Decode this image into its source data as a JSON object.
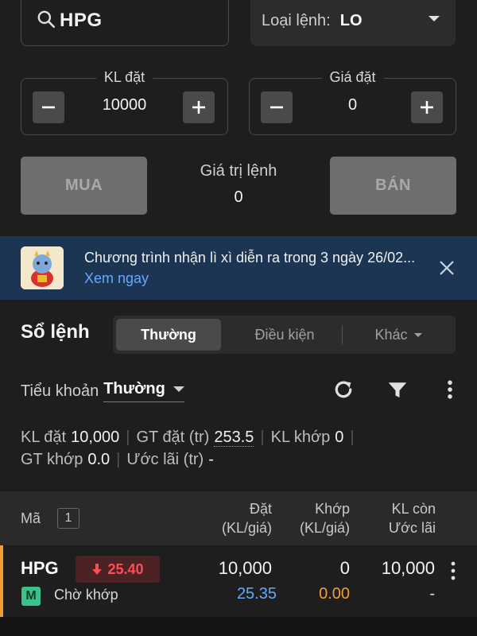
{
  "search": {
    "value": "HPG"
  },
  "order_type": {
    "label": "Loại lệnh:",
    "value": "LO"
  },
  "quantity": {
    "label": "KL đặt",
    "value": "10000"
  },
  "price": {
    "label": "Giá đặt",
    "value": "0"
  },
  "buy": {
    "label": "MUA"
  },
  "sell": {
    "label": "BÁN"
  },
  "order_value": {
    "label": "Giá trị lệnh",
    "value": "0"
  },
  "banner": {
    "text": "Chương trình nhận lì xì diễn ra trong 3 ngày 26/02...",
    "link": "Xem ngay"
  },
  "order_book": {
    "title": "Sổ lệnh",
    "tabs": [
      {
        "label": "Thường",
        "active": true
      },
      {
        "label": "Điều kiện",
        "active": false
      },
      {
        "label": "Khác",
        "active": false
      }
    ]
  },
  "sub_account": {
    "label": "Tiểu khoản",
    "value": "Thường"
  },
  "stats": {
    "kl_dat_label": "KL đặt",
    "kl_dat_value": "10,000",
    "gt_dat_label": "GT đặt (tr)",
    "gt_dat_value": "253.5",
    "kl_khop_label": "KL khớp",
    "kl_khop_value": "0",
    "gt_khop_label": "GT khớp",
    "gt_khop_value": "0.0",
    "uoc_lai_label": "Ước lãi (tr)",
    "uoc_lai_value": "-"
  },
  "table": {
    "col_code": "Mã",
    "count": "1",
    "col_dat_1": "Đặt",
    "col_dat_2": "(KL/giá)",
    "col_khop_1": "Khớp",
    "col_khop_2": "(KL/giá)",
    "col_klcon_1": "KL còn",
    "col_klcon_2": "Ước lãi",
    "rows": [
      {
        "symbol": "HPG",
        "price": "25.40",
        "market": "M",
        "status": "Chờ khớp",
        "dat_kl": "10,000",
        "dat_gia": "25.35",
        "khop_kl": "0",
        "khop_gia": "0.00",
        "kl_con": "10,000",
        "uoc_lai": "-"
      }
    ]
  },
  "colors": {
    "background": "#1e1e1e",
    "accent_blue": "#62a9ff",
    "down_red": "#ff4d55",
    "khop_orange": "#f0a030",
    "market_green": "#39c28a"
  },
  "icons": [
    "search-icon",
    "chevron-down-icon",
    "minus-icon",
    "plus-icon",
    "close-icon",
    "refresh-icon",
    "filter-icon",
    "more-vertical-icon",
    "arrow-down-icon"
  ]
}
